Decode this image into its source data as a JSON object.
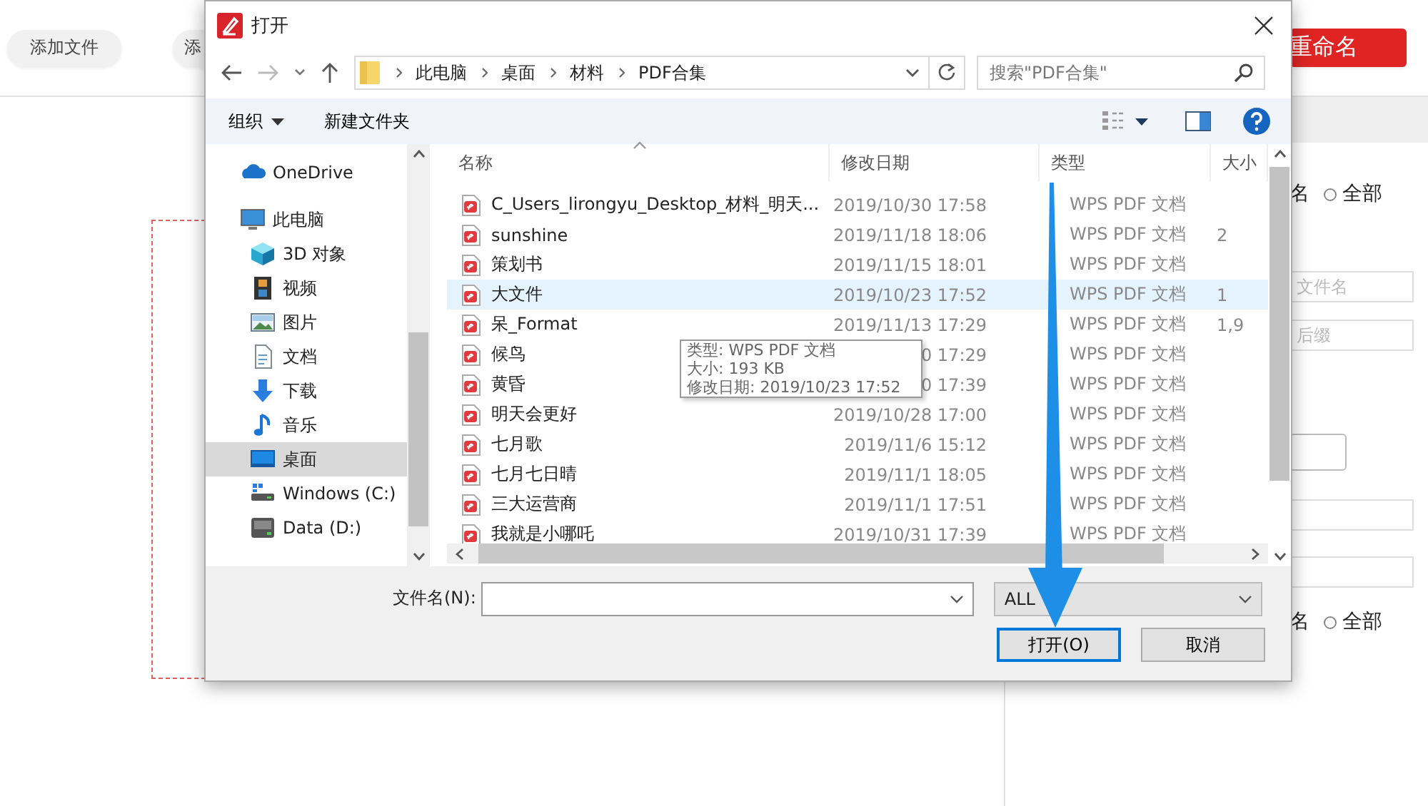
{
  "app": {
    "toolbar": [
      {
        "kind": "plain",
        "label": "添加文件"
      },
      {
        "kind": "plain",
        "label": "添"
      },
      {
        "kind": "primary",
        "label": "重命名"
      }
    ],
    "right_panel": [
      {
        "kind": "radio",
        "tail": "名",
        "option": "全部",
        "selected": false
      },
      {
        "kind": "field",
        "placeholder": "文件名"
      },
      {
        "kind": "field",
        "placeholder": "后缀"
      },
      {
        "kind": "button"
      },
      {
        "kind": "field"
      },
      {
        "kind": "field"
      },
      {
        "kind": "radio",
        "tail": "名",
        "option": "全部",
        "selected": false
      }
    ]
  },
  "dialog": {
    "title": "打开",
    "breadcrumbs": [
      "此电脑",
      "桌面",
      "材料",
      "PDF合集"
    ],
    "search": {
      "placeholder": "搜索\"PDF合集\""
    },
    "commands": [
      "组织",
      "新建文件夹"
    ],
    "nav": [
      {
        "label": "OneDrive",
        "selected": false
      },
      {
        "label": "此电脑",
        "selected": false,
        "children": [
          {
            "label": "3D 对象",
            "selected": false
          },
          {
            "label": "视频",
            "selected": false
          },
          {
            "label": "图片",
            "selected": false
          },
          {
            "label": "文档",
            "selected": false
          },
          {
            "label": "下载",
            "selected": false
          },
          {
            "label": "音乐",
            "selected": false
          },
          {
            "label": "桌面",
            "selected": true
          },
          {
            "label": "Windows (C:)",
            "selected": false
          },
          {
            "label": "Data (D:)",
            "selected": false
          }
        ]
      }
    ],
    "columns": [
      "名称",
      "修改日期",
      "类型",
      "大小"
    ],
    "files": [
      {
        "name": "C_Users_lirongyu_Desktop_材料_明天...",
        "date": "2019/10/30 17:58",
        "type": "WPS PDF 文档",
        "selected": false
      },
      {
        "name": "sunshine",
        "date": "2019/11/18 18:06",
        "type": "WPS PDF 文档",
        "size": "2",
        "selected": false
      },
      {
        "name": "策划书",
        "date": "2019/11/15 18:01",
        "type": "WPS PDF 文档",
        "selected": false
      },
      {
        "name": "大文件",
        "date": "2019/10/23 17:52",
        "type": "WPS PDF 文档",
        "size": "1",
        "selected": true
      },
      {
        "name": "呆_Format",
        "date": "2019/11/13 17:29",
        "type": "WPS PDF 文档",
        "size": "1,9",
        "selected": false
      },
      {
        "name": "候鸟",
        "date": "0 17:29",
        "type": "WPS PDF 文档",
        "selected": false
      },
      {
        "name": "黄昏",
        "date": "0 17:39",
        "type": "WPS PDF 文档",
        "selected": false
      },
      {
        "name": "明天会更好",
        "date": "2019/10/28 17:00",
        "type": "WPS PDF 文档",
        "selected": false
      },
      {
        "name": "七月歌",
        "date": "2019/11/6 15:12",
        "type": "WPS PDF 文档",
        "selected": false
      },
      {
        "name": "七月七日晴",
        "date": "2019/11/1 18:05",
        "type": "WPS PDF 文档",
        "selected": false
      },
      {
        "name": "三大运营商",
        "date": "2019/11/1 17:51",
        "type": "WPS PDF 文档",
        "selected": false
      },
      {
        "name": "我就是小哪吒",
        "date": "2019/10/31 17:39",
        "type": "WPS PDF 文档",
        "selected": false
      }
    ],
    "tooltip": [
      "类型: WPS PDF 文档",
      "大小: 193 KB",
      "修改日期: 2019/10/23 17:52"
    ],
    "filename": {
      "label": "文件名(N):"
    },
    "filter": {
      "value": "ALL"
    },
    "buttons": [
      {
        "label": "打开(O)",
        "selected": true
      },
      {
        "label": "取消",
        "selected": false
      }
    ]
  },
  "annotation": {
    "kind": "arrow"
  }
}
